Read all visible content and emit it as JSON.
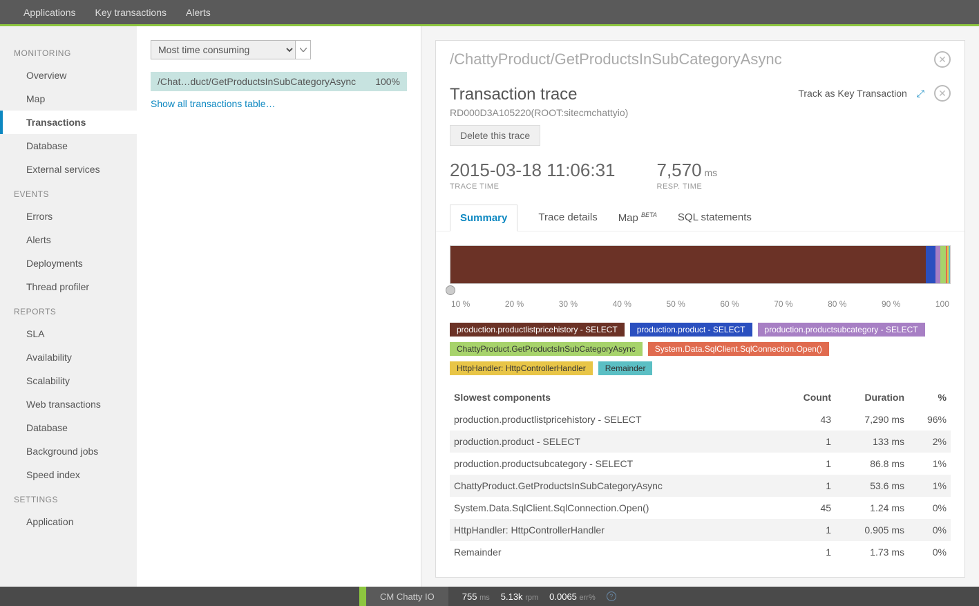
{
  "topnav": {
    "applications": "Applications",
    "keyTransactions": "Key transactions",
    "alerts": "Alerts"
  },
  "sidebar": {
    "sections": [
      {
        "title": "MONITORING",
        "items": [
          "Overview",
          "Map",
          "Transactions",
          "Database",
          "External services"
        ],
        "activeIndex": 2
      },
      {
        "title": "EVENTS",
        "items": [
          "Errors",
          "Alerts",
          "Deployments",
          "Thread profiler"
        ]
      },
      {
        "title": "REPORTS",
        "items": [
          "SLA",
          "Availability",
          "Scalability",
          "Web transactions",
          "Database",
          "Background jobs",
          "Speed index"
        ]
      },
      {
        "title": "SETTINGS",
        "items": [
          "Application"
        ]
      }
    ]
  },
  "middle": {
    "selectLabel": "Most time consuming",
    "txnName": "/Chat…duct/GetProductsInSubCategoryAsync",
    "txnPct": "100%",
    "showAll": "Show all transactions table…"
  },
  "detail": {
    "breadcrumb": "/ChattyProduct/GetProductsInSubCategoryAsync",
    "title": "Transaction trace",
    "trackLabel": "Track as Key Transaction",
    "subtitle": "RD000D3A105220(ROOT:sitecmchattyio)",
    "deleteLabel": "Delete this trace",
    "traceTime": "2015-03-18 11:06:31",
    "traceTimeLabel": "TRACE TIME",
    "respTime": "7,570",
    "respUnit": "ms",
    "respLabel": "RESP. TIME",
    "tabs": [
      "Summary",
      "Trace details",
      "Map",
      "SQL statements"
    ],
    "mapBeta": "BETA",
    "tableHeaders": {
      "name": "Slowest components",
      "count": "Count",
      "duration": "Duration",
      "pct": "%"
    }
  },
  "chart_data": {
    "type": "bar",
    "orientation": "stacked-horizontal",
    "xlabel": "",
    "ylabel": "",
    "axis_ticks": [
      "10 %",
      "20 %",
      "30 %",
      "40 %",
      "50 %",
      "60 %",
      "70 %",
      "80 %",
      "90 %",
      "100"
    ],
    "series": [
      {
        "name": "production.productlistpricehistory - SELECT",
        "color": "#6b3226",
        "pct": 96
      },
      {
        "name": "production.product - SELECT",
        "color": "#2a4fbf",
        "pct": 2
      },
      {
        "name": "production.productsubcategory - SELECT",
        "color": "#a77fc4",
        "pct": 1
      },
      {
        "name": "ChattyProduct.GetProductsInSubCategoryAsync",
        "color": "#a7d36b",
        "pct": 1
      },
      {
        "name": "System.Data.SqlClient.SqlConnection.Open()",
        "color": "#e06b4f",
        "pct": 0
      },
      {
        "name": "HttpHandler: HttpControllerHandler",
        "color": "#e8c547",
        "pct": 0
      },
      {
        "name": "Remainder",
        "color": "#5bbfc4",
        "pct": 0
      }
    ]
  },
  "components": [
    {
      "name": "production.productlistpricehistory - SELECT",
      "count": "43",
      "duration": "7,290 ms",
      "pct": "96%"
    },
    {
      "name": "production.product - SELECT",
      "count": "1",
      "duration": "133 ms",
      "pct": "2%"
    },
    {
      "name": "production.productsubcategory - SELECT",
      "count": "1",
      "duration": "86.8 ms",
      "pct": "1%"
    },
    {
      "name": "ChattyProduct.GetProductsInSubCategoryAsync",
      "count": "1",
      "duration": "53.6 ms",
      "pct": "1%"
    },
    {
      "name": "System.Data.SqlClient.SqlConnection.Open()",
      "count": "45",
      "duration": "1.24 ms",
      "pct": "0%"
    },
    {
      "name": "HttpHandler: HttpControllerHandler",
      "count": "1",
      "duration": "0.905 ms",
      "pct": "0%"
    },
    {
      "name": "Remainder",
      "count": "1",
      "duration": "1.73 ms",
      "pct": "0%"
    }
  ],
  "footer": {
    "appName": "CM Chatty IO",
    "m1": "755",
    "u1": "ms",
    "m2": "5.13k",
    "u2": "rpm",
    "m3": "0.0065",
    "u3": "err%"
  }
}
